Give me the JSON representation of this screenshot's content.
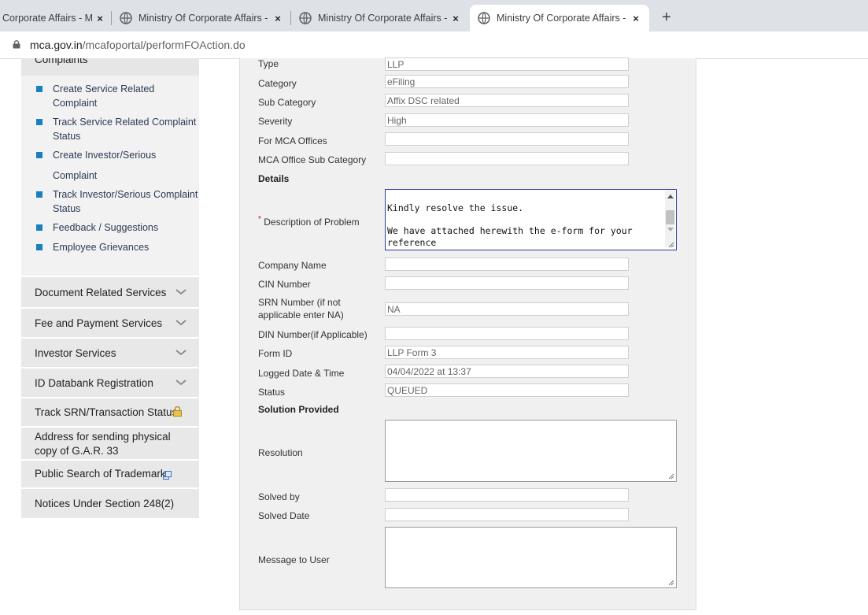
{
  "browser": {
    "tabs": [
      {
        "title": "f Corporate Affairs - M"
      },
      {
        "title": "Ministry Of Corporate Affairs - M"
      },
      {
        "title": "Ministry Of Corporate Affairs - M"
      },
      {
        "title": "Ministry Of Corporate Affairs - M"
      }
    ],
    "close_glyph": "×",
    "new_tab_glyph": "+",
    "url_domain": "mca.gov.in",
    "url_path": "/mcafoportal/performFOAction.do"
  },
  "sidebar": {
    "header": "Complaints",
    "sub_items": [
      {
        "label": "Create Service Related Complaint"
      },
      {
        "label": "Track Service Related Complaint Status"
      },
      {
        "label": "Create Investor/Serious"
      },
      {
        "label": "Complaint"
      },
      {
        "label": "Track Investor/Serious Complaint Status"
      },
      {
        "label": "Feedback / Suggestions"
      },
      {
        "label": "Employee Grievances"
      }
    ],
    "items": [
      {
        "label": "Document Related Services"
      },
      {
        "label": "Fee and Payment Services"
      },
      {
        "label": "Investor Services"
      },
      {
        "label": "ID Databank Registration"
      },
      {
        "label": "Track SRN/Transaction Status"
      },
      {
        "label": "Address for sending physical copy of G.A.R. 33"
      },
      {
        "label": "Public Search of Trademark"
      },
      {
        "label": "Notices Under Section 248(2)"
      }
    ]
  },
  "form": {
    "fields": [
      {
        "label": "Type",
        "value": "LLP"
      },
      {
        "label": "Category",
        "value": "eFiling"
      },
      {
        "label": "Sub Category",
        "value": "Affix DSC related"
      },
      {
        "label": "Severity",
        "value": "High"
      },
      {
        "label": "For MCA Offices",
        "value": ""
      },
      {
        "label": "MCA Office Sub Category",
        "value": ""
      }
    ],
    "details_heading": "Details",
    "description": {
      "required_mark": "*",
      "label": "Description of Problem",
      "text": "Kindly resolve the issue.\n\nWe have attached herewith the e-form for your\nreference"
    },
    "fields2": [
      {
        "label": "Company Name",
        "value": ""
      },
      {
        "label": "CIN Number",
        "value": ""
      },
      {
        "label": "SRN Number (if not applicable enter NA)",
        "value": "NA"
      },
      {
        "label": "DIN Number(if Applicable)",
        "value": ""
      },
      {
        "label": "Form ID",
        "value": "LLP Form 3"
      },
      {
        "label": "Logged Date & Time",
        "value": "04/04/2022 at 13:37"
      },
      {
        "label": "Status",
        "value": "QUEUED"
      }
    ],
    "solution_heading": "Solution Provided",
    "resolution": {
      "label": "Resolution",
      "value": ""
    },
    "solved_by": {
      "label": "Solved by",
      "value": ""
    },
    "solved_date": {
      "label": "Solved Date",
      "value": ""
    },
    "message_to_user": {
      "label": "Message to User",
      "value": ""
    }
  },
  "colors": {
    "bullet": "#1a7fc1",
    "focus_border": "#2a3a9a",
    "required": "#dd0000"
  }
}
